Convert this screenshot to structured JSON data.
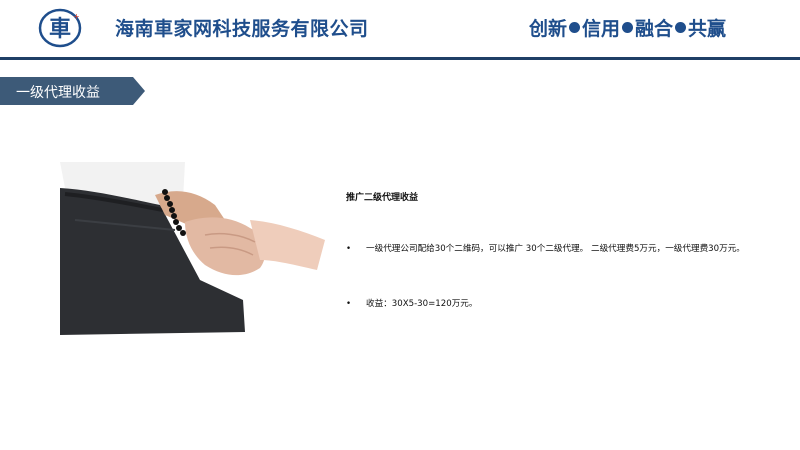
{
  "header": {
    "logo_char": "車",
    "company_name": "海南車家网科技服务有限公司",
    "slogan": [
      "创新",
      "信用",
      "融合",
      "共赢"
    ]
  },
  "section": {
    "title": "一级代理收益"
  },
  "content": {
    "heading": "推广二级代理收益",
    "bullets": [
      "一级代理公司配给30个二维码，可以推广 30个二级代理。 二级代理费5万元，一级代理费30万元。",
      "收益：30X5-30=120万元。"
    ]
  },
  "colors": {
    "brand": "#1f4e8c",
    "rule": "#1f3f66",
    "tab": "#3d5a78",
    "logo_red": "#d23c2a"
  },
  "icons": {
    "logo": "car-emblem-icon",
    "bullet": "bullet-dot",
    "photo": "handshake-photo"
  }
}
